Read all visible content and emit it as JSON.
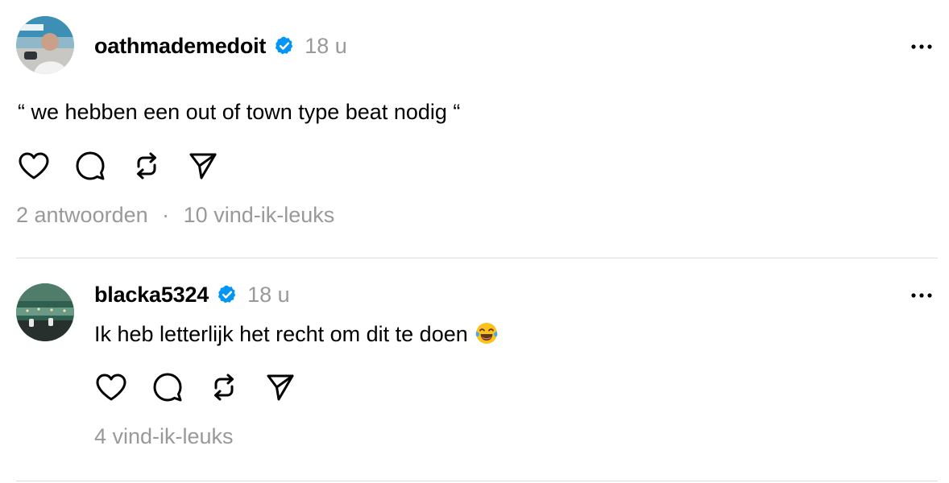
{
  "posts": [
    {
      "username": "oathmademedoit",
      "time": "18 u",
      "text": "“ we hebben een out of town type beat nodig “",
      "replies": "2 antwoorden",
      "separator": "·",
      "likes": "10 vind-ik-leuks"
    },
    {
      "username": "blacka5324",
      "time": "18 u",
      "text": "Ik heb letterlijk het recht om dit te doen",
      "emoji": "face-with-tears-of-joy",
      "likes": "4 vind-ik-leuks"
    }
  ],
  "icons": {
    "verified": "verified-badge-icon",
    "more": "more-options-icon",
    "like": "heart-icon",
    "comment": "comment-bubble-icon",
    "repost": "repost-icon",
    "share": "send-icon"
  },
  "colors": {
    "verified": "#0095f6",
    "secondary_text": "#999999",
    "divider": "#dcdcdc"
  }
}
